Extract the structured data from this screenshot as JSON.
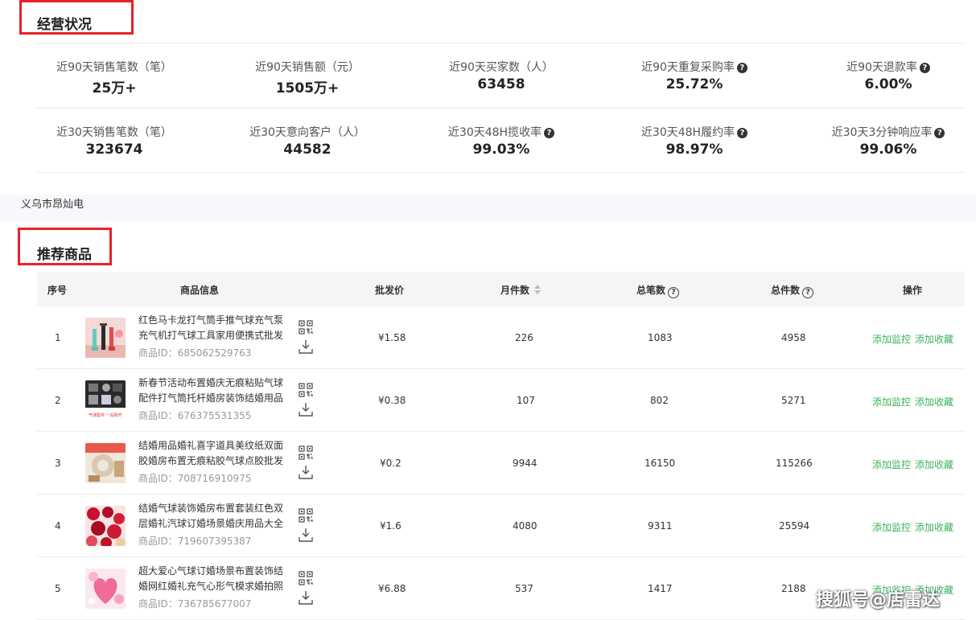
{
  "business": {
    "title": "经营状况",
    "stats": [
      [
        {
          "label": "近90天销售笔数（笔）",
          "value": "25万+",
          "help": false
        },
        {
          "label": "近90天销售额（元）",
          "value": "1505万+",
          "help": false
        },
        {
          "label": "近90天买家数（人）",
          "value": "63458",
          "help": false
        },
        {
          "label": "近90天重复采购率",
          "value": "25.72%",
          "help": true
        },
        {
          "label": "近90天退款率",
          "value": "6.00%",
          "help": true
        }
      ],
      [
        {
          "label": "近30天销售笔数（笔）",
          "value": "323674",
          "help": false
        },
        {
          "label": "近30天意向客户（人）",
          "value": "44582",
          "help": false
        },
        {
          "label": "近30天48H揽收率",
          "value": "99.03%",
          "help": true
        },
        {
          "label": "近30天48H履约率",
          "value": "98.97%",
          "help": true
        },
        {
          "label": "近30天3分钟响应率",
          "value": "99.06%",
          "help": true
        }
      ]
    ]
  },
  "shop_name": "义乌市昂灿电",
  "recommend": {
    "title": "推荐商品",
    "columns": {
      "index": "序号",
      "info": "商品信息",
      "price": "批发价",
      "monthly": "月件数",
      "orders": "总笔数",
      "total": "总件数",
      "ops": "操作"
    },
    "id_prefix": "商品ID：",
    "op_monitor": "添加监控",
    "op_collect": "添加收藏",
    "rows": [
      {
        "index": "1",
        "name": "红色马卡龙打气筒手推气球充气泵充气机打气球工具家用便携式批发",
        "id": "685062529763",
        "price": "¥1.58",
        "monthly": "226",
        "orders": "1083",
        "total": "4958"
      },
      {
        "index": "2",
        "name": "新春节活动布置婚庆无痕粘贴气球配件打气筒托杆婚房装饰结婚用品",
        "id": "676375531355",
        "price": "¥0.38",
        "monthly": "107",
        "orders": "802",
        "total": "5271"
      },
      {
        "index": "3",
        "name": "结婚用品婚礼喜字道具美纹纸双面胶婚房布置无痕粘胶气球点胶批发",
        "id": "708716910975",
        "price": "¥0.2",
        "monthly": "9944",
        "orders": "16150",
        "total": "115266"
      },
      {
        "index": "4",
        "name": "结婚气球装饰婚房布置套装红色双层婚礼汽球订婚场景婚庆用品大全",
        "id": "719607395387",
        "price": "¥1.6",
        "monthly": "4080",
        "orders": "9311",
        "total": "25594"
      },
      {
        "index": "5",
        "name": "超大爱心气球订婚场景布置装饰结婚网红婚礼充气心形气模求婚拍照",
        "id": "736785677007",
        "price": "¥6.88",
        "monthly": "537",
        "orders": "1417",
        "total": "2188"
      }
    ]
  },
  "thumb2_caption": "气球配件 一站购齐",
  "watermark": "搜狐号@店雷达",
  "colors": {
    "accent_red": "#e8202a",
    "link_green": "#3bb35a"
  }
}
